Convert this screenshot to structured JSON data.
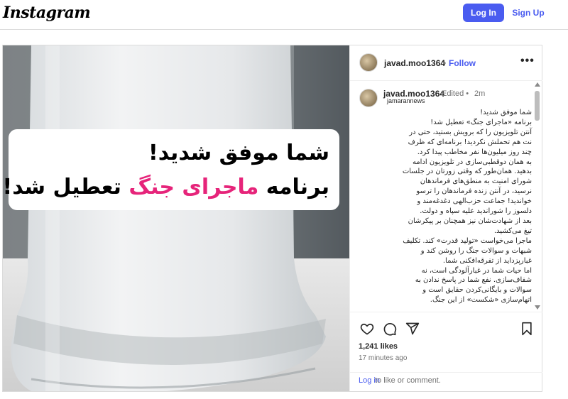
{
  "header": {
    "logo_text": "Instagram",
    "login_label": "Log In",
    "signup_label": "Sign Up"
  },
  "post": {
    "image_overlay": {
      "line1": "شما موفق شدید!",
      "line2_part1": "برنامه ",
      "line2_highlight": "ماجرای جنگ",
      "line2_part2": " تعطیل شد!",
      "highlight_color": "#e6247a"
    },
    "author": {
      "username": "javad.moo1364",
      "separator": "•",
      "follow_label": "Follow",
      "more_icon": "more-horizontal-icon"
    },
    "caption_header": {
      "username": "javad.moo1364",
      "edited": "Edited •",
      "age": "2m",
      "mention": "jamarannews"
    },
    "caption_lines": [
      "شما موفق شدید!",
      "برنامه «ماجرای جنگ» تعطیل شد!",
      "آنتن تلویزیون را که برویش بستید، حتی در",
      "نت هم تحملش نکردید! برنامه‌ای که ظرف",
      "چند روز میلیون‌ها نفر مخاطب پیدا کرد.",
      "به همان دوقطبی‌سازی در تلویزیون ادامه",
      "بدهید. همان‌طور که وقتی زورتان در جلسات",
      "شورای امنیت به منطق‌های فرماندهان",
      "نرسید، در آنتن زنده فرماندهان را ترسو",
      "خواندید! جماعت حزب‌الهی دغدغه‌مند و",
      "دلسوز را شوراندید علیه سپاه و دولت.",
      "بعد از شهادت‌شان نیز همچنان بر پیکرشان",
      "تیغ می‌کشید.",
      "ماجرا می‌خواست «تولید قدرت» کند. تکلیف",
      "شبهات و سوالات جنگ را روشن کند و",
      "غبارپزداید از تفرقه‌افکنی شما.",
      "اما حیات شما در غبارآلودگی است، نه",
      "شفاف‌سازی. نفع شما در پاسخ ندادن به",
      "سوالات و بایگانی‌کردن حقایق است و",
      "اتهام‌سازی «شکست» از این جنگ."
    ],
    "actions": {
      "like_icon": "heart-icon",
      "comment_icon": "comment-icon",
      "share_icon": "share-icon",
      "save_icon": "bookmark-icon",
      "likes_text": "1,241 likes",
      "time_text": "17 minutes ago"
    },
    "comment_prompt": {
      "login_link": "Log in",
      "rest": " to like or comment."
    }
  },
  "colors": {
    "accent": "#4a5cf0",
    "text": "#262626",
    "muted": "#737373",
    "border": "#dbdbdb"
  }
}
